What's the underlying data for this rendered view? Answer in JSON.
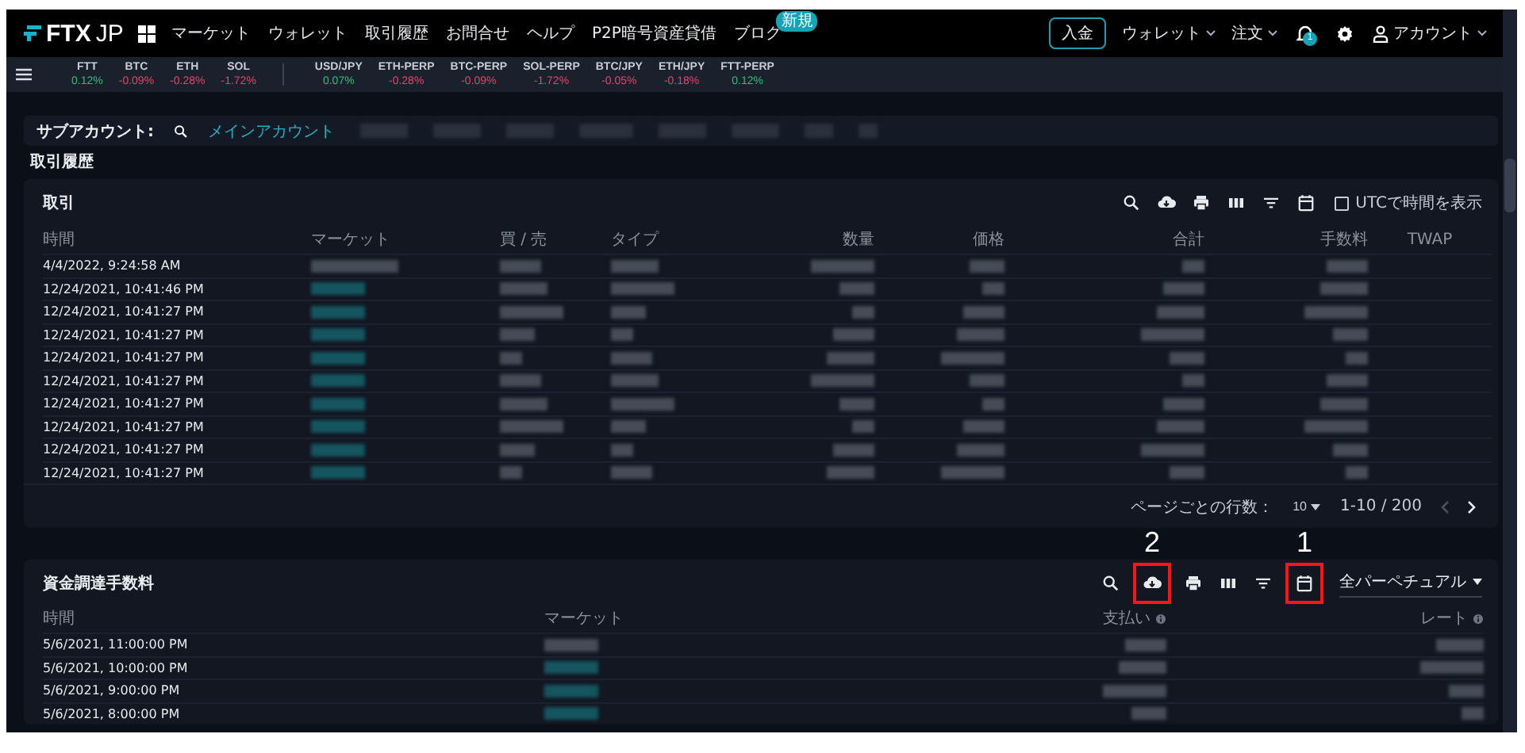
{
  "nav": {
    "logo": "FTX",
    "logo_suffix": "JP",
    "menu": [
      {
        "label": "マーケット"
      },
      {
        "label": "ウォレット"
      },
      {
        "label": "取引履歴"
      },
      {
        "label": "お問合せ"
      },
      {
        "label": "ヘルプ"
      },
      {
        "label": "P2P暗号資産貸借"
      },
      {
        "label": "ブログ",
        "badge": "新規"
      }
    ],
    "deposit_button": "入金",
    "dropdowns": [
      "ウォレット",
      "注文"
    ],
    "notification_badge": "1",
    "account": "アカウント"
  },
  "ticker_groups": [
    {
      "items": [
        {
          "symbol": "FTT",
          "change": "0.12%",
          "color": "#2fbf7a"
        },
        {
          "symbol": "BTC",
          "change": "-0.09%",
          "color": "#e2486a"
        },
        {
          "symbol": "ETH",
          "change": "-0.28%",
          "color": "#e2486a"
        },
        {
          "symbol": "SOL",
          "change": "-1.72%",
          "color": "#e2486a"
        }
      ]
    },
    {
      "items": [
        {
          "symbol": "USD/JPY",
          "change": "0.07%",
          "color": "#2fbf7a"
        },
        {
          "symbol": "ETH-PERP",
          "change": "-0.28%",
          "color": "#e2486a"
        },
        {
          "symbol": "BTC-PERP",
          "change": "-0.09%",
          "color": "#e2486a"
        },
        {
          "symbol": "SOL-PERP",
          "change": "-1.72%",
          "color": "#e2486a"
        },
        {
          "symbol": "BTC/JPY",
          "change": "-0.05%",
          "color": "#e2486a"
        },
        {
          "symbol": "ETH/JPY",
          "change": "-0.18%",
          "color": "#e2486a"
        },
        {
          "symbol": "FTT-PERP",
          "change": "0.12%",
          "color": "#2fbf7a"
        }
      ]
    }
  ],
  "subaccounts": {
    "label": "サブアカウント:",
    "items": [
      {
        "label": "メインアカウント",
        "selected": true
      }
    ]
  },
  "page_title": "取引履歴",
  "trades": {
    "title": "取引",
    "tools": [
      {
        "kind": "search"
      },
      {
        "kind": "download"
      },
      {
        "kind": "print"
      },
      {
        "kind": "columns"
      },
      {
        "kind": "filter"
      },
      {
        "kind": "calendar"
      }
    ],
    "utc_toggle": {
      "label": "UTCで時間を表示",
      "checked": false
    },
    "columns": [
      {
        "label": "時間",
        "kind": "time"
      },
      {
        "label": "マーケット",
        "kind": "market"
      },
      {
        "label": "買 / 売",
        "kind": "blurred"
      },
      {
        "label": "タイプ",
        "kind": "blurred"
      },
      {
        "label": "数量",
        "kind": "numeric"
      },
      {
        "label": "価格",
        "kind": "numeric"
      },
      {
        "label": "合計",
        "kind": "numeric"
      },
      {
        "label": "手数料",
        "kind": "numeric"
      },
      {
        "label": "TWAP",
        "kind": "empty"
      }
    ],
    "rows": [
      {
        "time": "4/4/2022, 9:24:58 AM"
      },
      {
        "time": "12/24/2021, 10:41:46 PM"
      },
      {
        "time": "12/24/2021, 10:41:27 PM"
      },
      {
        "time": "12/24/2021, 10:41:27 PM"
      },
      {
        "time": "12/24/2021, 10:41:27 PM"
      },
      {
        "time": "12/24/2021, 10:41:27 PM"
      },
      {
        "time": "12/24/2021, 10:41:27 PM"
      },
      {
        "time": "12/24/2021, 10:41:27 PM"
      },
      {
        "time": "12/24/2021, 10:41:27 PM"
      },
      {
        "time": "12/24/2021, 10:41:27 PM"
      }
    ],
    "pagination": {
      "rows_label": "ページごとの行数：",
      "rows_per_page": "10",
      "range": "1-10 / 200",
      "prev_disabled": true
    }
  },
  "funding": {
    "title": "資金調達手数料",
    "tools": [
      {
        "kind": "search"
      },
      {
        "kind": "download",
        "annotation": "2"
      },
      {
        "kind": "print"
      },
      {
        "kind": "columns"
      },
      {
        "kind": "filter"
      },
      {
        "kind": "calendar",
        "annotation": "1"
      }
    ],
    "market_filter": "全パーペチュアル",
    "columns": [
      {
        "label": "時間",
        "kind": "time"
      },
      {
        "label": "マーケット",
        "kind": "market"
      },
      {
        "label": "支払い",
        "kind": "numeric",
        "info": true
      },
      {
        "label": "レート",
        "kind": "numeric",
        "info": true
      }
    ],
    "rows": [
      {
        "time": "5/6/2021, 11:00:00 PM"
      },
      {
        "time": "5/6/2021, 10:00:00 PM"
      },
      {
        "time": "5/6/2021, 9:00:00 PM"
      },
      {
        "time": "5/6/2021, 8:00:00 PM"
      }
    ]
  }
}
